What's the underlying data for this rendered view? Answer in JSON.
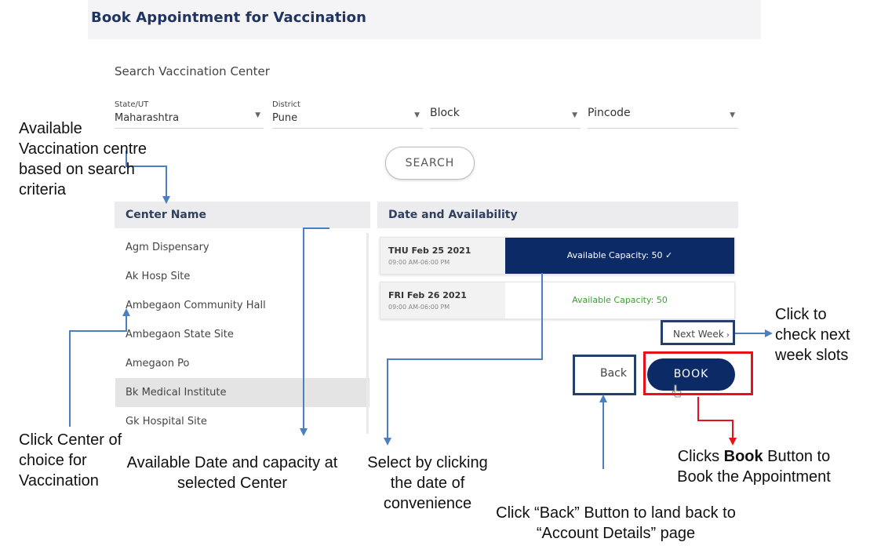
{
  "app": {
    "title": "Book Appointment for Vaccination"
  },
  "search": {
    "section_title": "Search Vaccination Center",
    "state": {
      "label": "State/UT",
      "value": "Maharashtra"
    },
    "district": {
      "label": "District",
      "value": "Pune"
    },
    "block": {
      "placeholder": "Block"
    },
    "pincode": {
      "placeholder": "Pincode"
    },
    "search_label": "SEARCH"
  },
  "centers": {
    "header": "Center Name",
    "items": [
      "Agm Dispensary",
      "Ak Hosp Site",
      "Ambegaon Community Hall",
      "Ambegaon State Site",
      "Amegaon Po",
      "Bk Medical Institute",
      "Gk Hospital Site"
    ],
    "selected": "Bk Medical Institute"
  },
  "availability": {
    "header": "Date and Availability",
    "slots": [
      {
        "date": "THU Feb 25 2021",
        "time": "09:00 AM-06:00 PM",
        "capacity": "Available Capacity: 50",
        "selected": true
      },
      {
        "date": "FRI Feb 26 2021",
        "time": "09:00 AM-06:00 PM",
        "capacity": "Available Capacity: 50",
        "selected": false
      }
    ],
    "next_week_label": "Next Week",
    "next_week_icon": "chevron-right-icon"
  },
  "actions": {
    "back_label": "Back",
    "book_label": "BOOK"
  },
  "colors": {
    "brand_navy": "#0b2a66",
    "available_green": "#3d9b35",
    "annotation_blue": "#4a7fc1",
    "annotation_red": "#e8111a",
    "annotation_box_blue": "#24406a"
  },
  "annotations": {
    "available_centres": "Available Vaccination centre based on search criteria",
    "click_center": "Click Center of choice for Vaccination",
    "available_date": "Available Date and capacity at selected Center",
    "select_date": "Select by clicking the date of convenience",
    "next_week": "Click to check next week slots",
    "back": "Click “Back” Button to land back to “Account Details” page",
    "book_prefix": "Clicks ",
    "book_bold": "Book",
    "book_suffix": " Button to Book the Appointment"
  }
}
